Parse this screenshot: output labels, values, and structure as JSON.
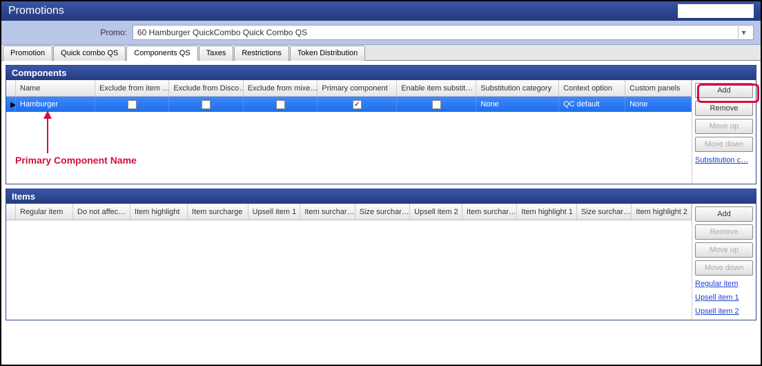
{
  "title": "Promotions",
  "promo_label": "Promo:",
  "promo_value": "60 Hamburger QuickCombo Quick Combo QS",
  "tabs": [
    {
      "label": "Promotion"
    },
    {
      "label": "Quick combo QS"
    },
    {
      "label": "Components QS",
      "active": true
    },
    {
      "label": "Taxes"
    },
    {
      "label": "Restrictions"
    },
    {
      "label": "Token Distribution"
    }
  ],
  "components": {
    "title": "Components",
    "cols": [
      "Name",
      "Exclude from item …",
      "Exclude from Disco…",
      "Exclude from mixe…",
      "Primary component",
      "Enable item substit…",
      "Substitution category",
      "Context option",
      "Custom panels"
    ],
    "rows": [
      {
        "indicator": "▶",
        "name": "Hamburger",
        "excl_item": false,
        "excl_disc": false,
        "excl_mix": false,
        "primary": true,
        "enable_sub": false,
        "sub_cat": "None",
        "context": "QC default",
        "custom": "None"
      }
    ],
    "buttons": {
      "add": "Add",
      "remove": "Remove",
      "moveup": "Move up",
      "movedown": "Move down"
    },
    "sub_link": "Substitution  c…"
  },
  "items": {
    "title": "Items",
    "cols": [
      "Regular item",
      "Do not affec…",
      "Item highlight",
      "Item surcharge",
      "Upsell item 1",
      "Item surchar…",
      "Size surchar…",
      "Upsell item 2",
      "Item surchar…",
      "Item highlight 1",
      "Size surchar…",
      "Item highlight 2"
    ],
    "buttons": {
      "add": "Add",
      "remove": "Remove",
      "moveup": "Move up",
      "movedown": "Move down"
    },
    "links": [
      "Regular item",
      "Upsell item 1",
      "Upsell item 2"
    ]
  },
  "annotation": {
    "label": "Primary Component Name"
  }
}
